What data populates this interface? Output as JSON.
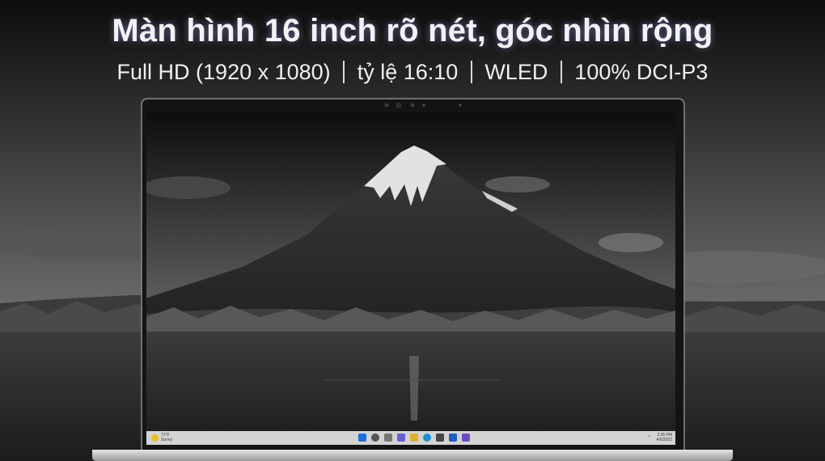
{
  "headline": "Màn hình 16 inch rõ nét, góc nhìn rộng",
  "specs": {
    "resolution": "Full HD (1920 x 1080)",
    "ratio": "tỷ lệ 16:10",
    "panel": "WLED",
    "color_gamut": "100% DCI-P3"
  },
  "taskbar": {
    "weather_temp": "71°F",
    "weather_desc": "Sunny",
    "time": "2:36 PM",
    "date": "4/6/2022",
    "tray_chevron": "⌃"
  },
  "colors": {
    "headline_glow": "#aab0ff",
    "taskbar_bg": "#d3d3d3",
    "start_blue": "#1e6fd9",
    "weather_sun": "#e8c020"
  }
}
